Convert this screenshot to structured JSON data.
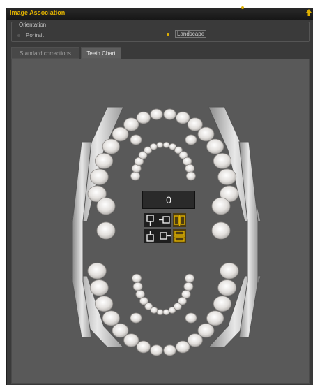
{
  "window": {
    "title": "Image Association",
    "collapse_icon": "collapse-arrow-icon"
  },
  "orientation": {
    "group_label": "Orientation",
    "options": [
      {
        "label": "Portrait",
        "selected": false
      },
      {
        "label": "Landscape",
        "selected": true
      }
    ]
  },
  "tabs": [
    {
      "label": "Standard corrections",
      "active": false
    },
    {
      "label": "Teeth Chart",
      "active": true
    }
  ],
  "teeth_chart": {
    "count": "0",
    "controls": [
      {
        "name": "upper-single-icon"
      },
      {
        "name": "upper-horizontal-icon"
      },
      {
        "name": "upper-mirror-icon",
        "highlighted": true
      },
      {
        "name": "lower-single-icon"
      },
      {
        "name": "lower-horizontal-icon"
      },
      {
        "name": "lower-flip-icon",
        "highlighted": true
      }
    ]
  },
  "colors": {
    "accent": "#e0b100",
    "panel": "#595959",
    "tooth": "#e6e3e0"
  }
}
